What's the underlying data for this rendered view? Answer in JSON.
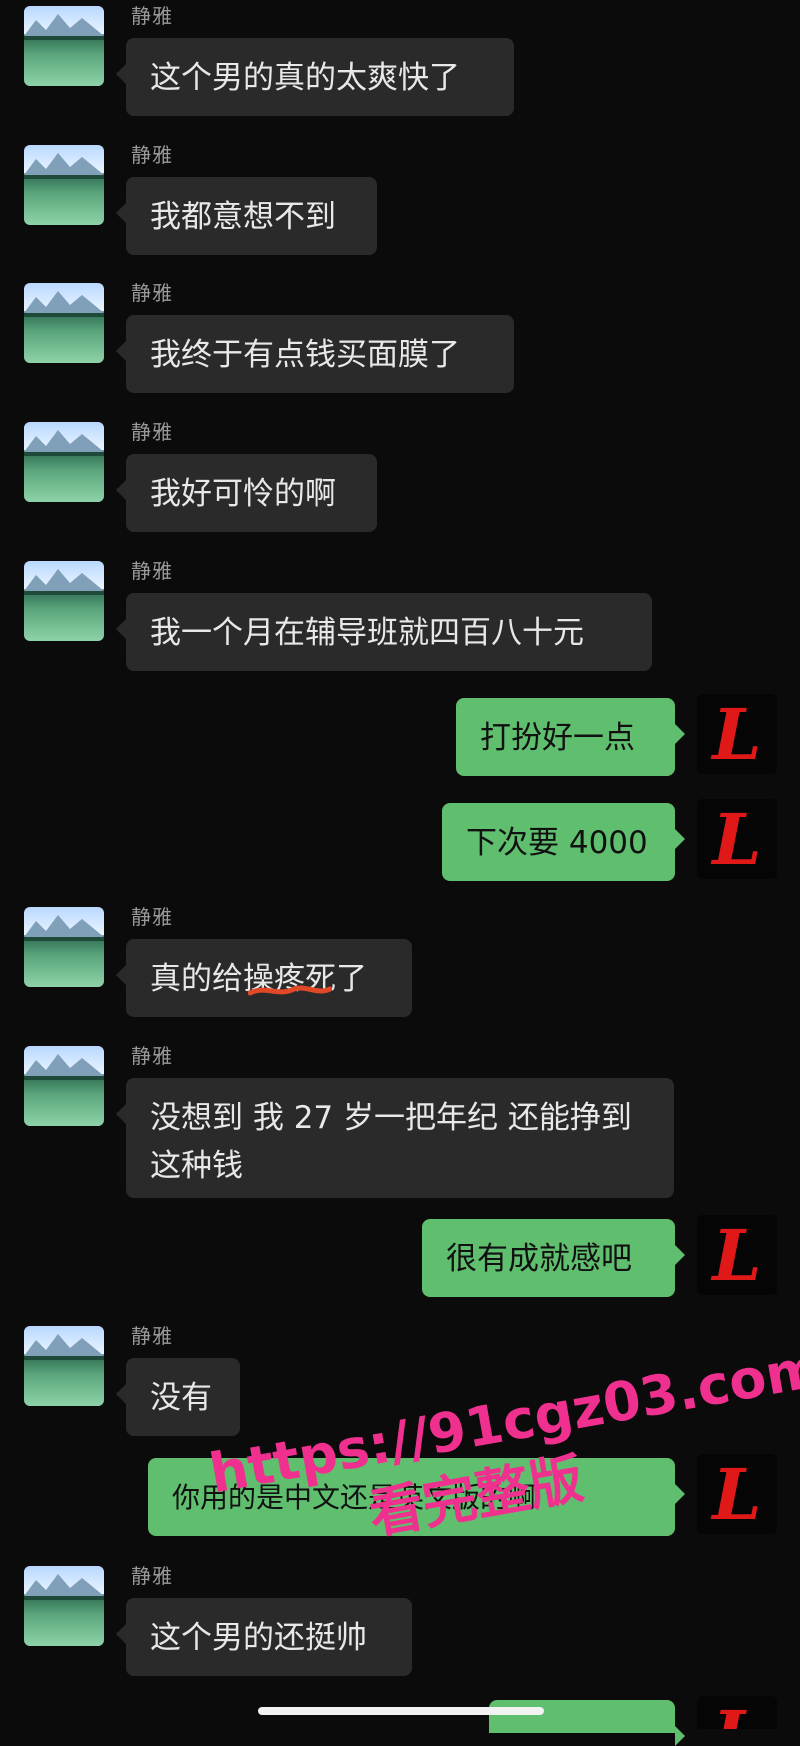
{
  "sender_name": "静雅",
  "messages": [
    {
      "side": "left",
      "text": "这个男的真的太爽快了"
    },
    {
      "side": "left",
      "text": "我都意想不到"
    },
    {
      "side": "left",
      "text": "我终于有点钱买面膜了"
    },
    {
      "side": "left",
      "text": "我好可怜的啊"
    },
    {
      "side": "left",
      "text": "我一个月在辅导班就四百八十元"
    },
    {
      "side": "right",
      "text": "打扮好一点"
    },
    {
      "side": "right",
      "text": "下次要 4000"
    },
    {
      "side": "left",
      "text": "真的给操疼死了"
    },
    {
      "side": "left",
      "text": "没想到 我 27 岁一把年纪 还能挣到\n这种钱"
    },
    {
      "side": "right",
      "text": "很有成就感吧"
    },
    {
      "side": "left",
      "text": "没有"
    },
    {
      "side": "right",
      "text": "你用的是中文还是英文版的啊"
    },
    {
      "side": "left",
      "text": "这个男的还挺帅"
    }
  ],
  "my_avatar_letter": "L",
  "watermark": {
    "url": "https://91cgz03.com",
    "sub": "看完整版"
  },
  "colors": {
    "background": "#0b0b0b",
    "left_bubble": "#2a2a2a",
    "right_bubble": "#5fbf6e",
    "watermark": "#f0308f",
    "avatar_letter": "#e01818"
  }
}
